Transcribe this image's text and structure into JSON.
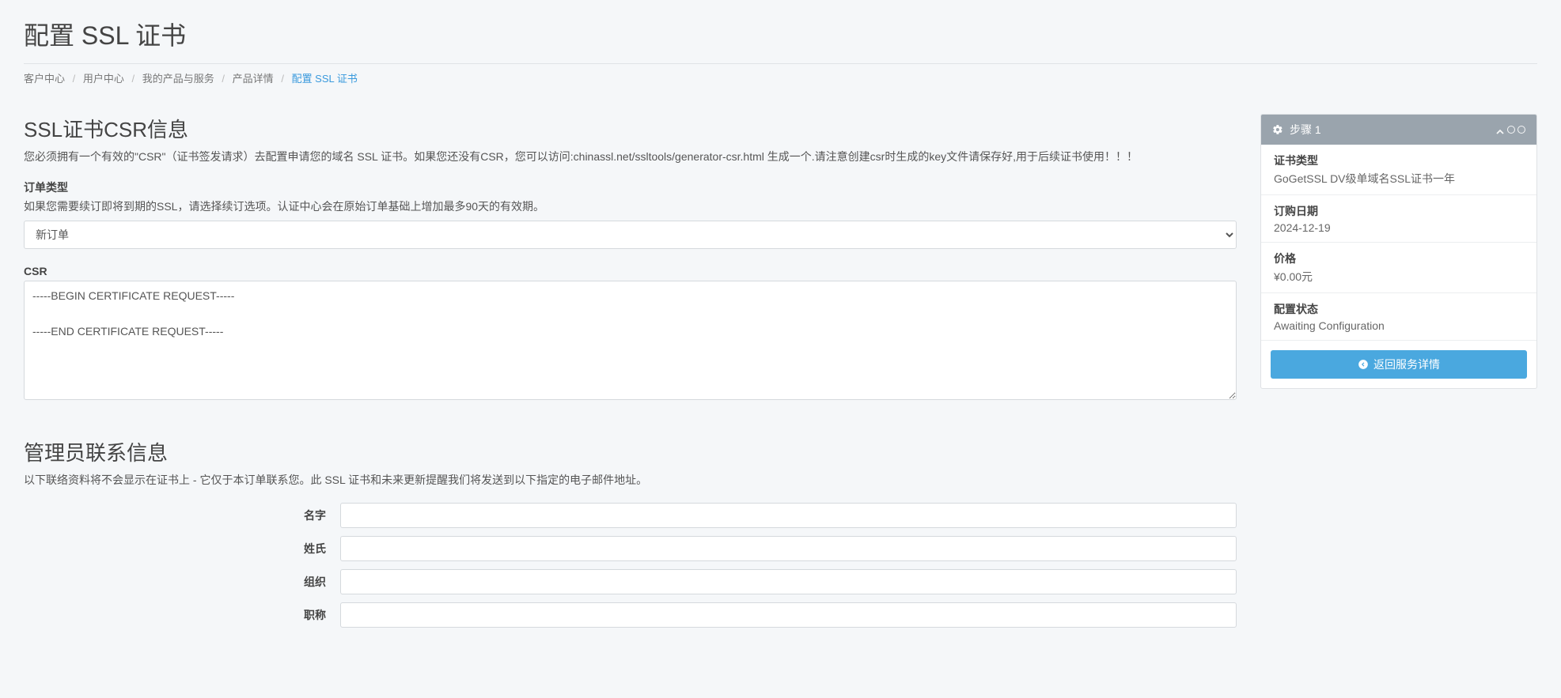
{
  "page_title": "配置 SSL 证书",
  "breadcrumbs": {
    "items": [
      "客户中心",
      "用户中心",
      "我的产品与服务",
      "产品详情"
    ],
    "current": "配置 SSL 证书"
  },
  "csr_section": {
    "title": "SSL证书CSR信息",
    "desc": "您必须拥有一个有效的\"CSR\"（证书签发请求）去配置申请您的域名 SSL 证书。如果您还没有CSR，您可以访问:chinassl.net/ssltools/generator-csr.html 生成一个.请注意创建csr时生成的key文件请保存好,用于后续证书使用！！！",
    "order_type_label": "订单类型",
    "order_type_hint": "如果您需要续订即将到期的SSL，请选择续订选项。认证中心会在原始订单基础上增加最多90天的有效期。",
    "order_type_selected": "新订单",
    "csr_label": "CSR",
    "csr_value": "-----BEGIN CERTIFICATE REQUEST-----\n\n-----END CERTIFICATE REQUEST-----"
  },
  "admin_section": {
    "title": "管理员联系信息",
    "desc": "以下联络资料将不会显示在证书上 - 它仅于本订单联系您。此 SSL 证书和未来更新提醒我们将发送到以下指定的电子邮件地址。",
    "fields": {
      "firstname_label": "名字",
      "lastname_label": "姓氏",
      "org_label": "组织",
      "title_label": "职称"
    }
  },
  "sidebar": {
    "header": "步骤 1",
    "items": [
      {
        "k": "证书类型",
        "v": "GoGetSSL DV级单域名SSL证书一年"
      },
      {
        "k": "订购日期",
        "v": "2024-12-19"
      },
      {
        "k": "价格",
        "v": "¥0.00元"
      },
      {
        "k": "配置状态",
        "v": "Awaiting Configuration"
      }
    ],
    "back_button": "返回服务详情"
  }
}
